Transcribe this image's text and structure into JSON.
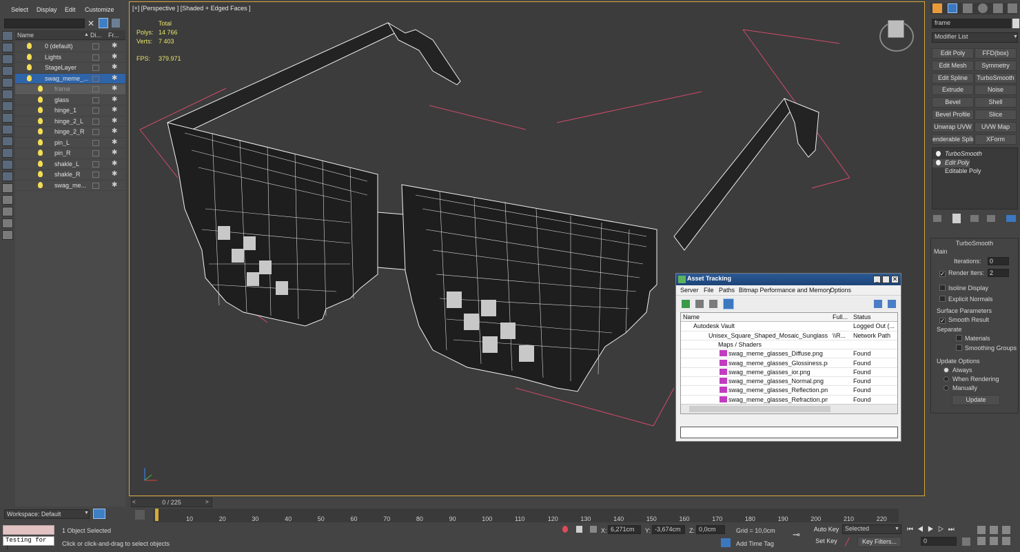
{
  "menu": {
    "select": "Select",
    "display": "Display",
    "edit": "Edit",
    "customize": "Customize"
  },
  "explorer": {
    "col_name": "Name",
    "col_display": "Di...",
    "col_freeze": "Fr...",
    "items": [
      {
        "label": "0 (default)",
        "indent": 0
      },
      {
        "label": "Lights",
        "indent": 0
      },
      {
        "label": "StageLayer",
        "indent": 0
      },
      {
        "label": "swag_meme_...",
        "indent": 0,
        "selected": true
      },
      {
        "label": "frame",
        "indent": 1,
        "highlight": true
      },
      {
        "label": "glass",
        "indent": 1
      },
      {
        "label": "hinge_1",
        "indent": 1
      },
      {
        "label": "hinge_2_L",
        "indent": 1
      },
      {
        "label": "hinge_2_R",
        "indent": 1
      },
      {
        "label": "pin_L",
        "indent": 1
      },
      {
        "label": "pin_R",
        "indent": 1
      },
      {
        "label": "shakle_L",
        "indent": 1
      },
      {
        "label": "shakle_R",
        "indent": 1
      },
      {
        "label": "swag_me...",
        "indent": 1
      }
    ],
    "workspace": "Workspace: Default"
  },
  "viewport": {
    "label": "[+] [Perspective ] [Shaded + Edged Faces ]",
    "stats": {
      "total": "Total",
      "polys_label": "Polys:",
      "polys": "14 766",
      "verts_label": "Verts:",
      "verts": "7 403",
      "fps_label": "FPS:",
      "fps": "379.971"
    }
  },
  "asset_tracking": {
    "title": "Asset Tracking",
    "menu": [
      "Server",
      "File",
      "Paths",
      "Bitmap Performance and Memory",
      "Options"
    ],
    "headers": [
      "Name",
      "Full...",
      "Status"
    ],
    "rows": [
      {
        "name": "Autodesk Vault",
        "full": "",
        "status": "Logged Out (...",
        "indent": 18
      },
      {
        "name": "Unisex_Square_Shaped_Mosaic_Sunglasse...",
        "full": "\\\\R...",
        "status": "Network Path",
        "indent": 40
      },
      {
        "name": "Maps / Shaders",
        "full": "",
        "status": "",
        "indent": 54
      },
      {
        "name": "swag_meme_glasses_Diffuse.png",
        "full": "",
        "status": "Found",
        "indent": 56,
        "png": true
      },
      {
        "name": "swag_meme_glasses_Glossiness.png",
        "full": "",
        "status": "Found",
        "indent": 56,
        "png": true
      },
      {
        "name": "swag_meme_glasses_ior.png",
        "full": "",
        "status": "Found",
        "indent": 56,
        "png": true
      },
      {
        "name": "swag_meme_glasses_Normal.png",
        "full": "",
        "status": "Found",
        "indent": 56,
        "png": true
      },
      {
        "name": "swag_meme_glasses_Reflection.png",
        "full": "",
        "status": "Found",
        "indent": 56,
        "png": true
      },
      {
        "name": "swag_meme_glasses_Refraction.png",
        "full": "",
        "status": "Found",
        "indent": 56,
        "png": true
      }
    ]
  },
  "command_panel": {
    "object_name": "frame",
    "modifier_list": "Modifier List",
    "modifier_buttons": [
      "Edit Poly",
      "FFD(box)",
      "Edit Mesh",
      "Symmetry",
      "Edit Spline",
      "TurboSmooth",
      "Extrude",
      "Noise",
      "Bevel",
      "Shell",
      "Bevel Profile",
      "Slice",
      "Unwrap UVW",
      "UVW Map",
      "enderable Splin",
      "XForm"
    ],
    "stack": [
      "TurboSmooth",
      "Edit Poly",
      "Editable Poly"
    ],
    "rollout_title": "TurboSmooth",
    "main": "Main",
    "iterations_label": "Iterations:",
    "iterations": "0",
    "render_iters_label": "Render Iters:",
    "render_iters": "2",
    "isoline": "Isoline Display",
    "explicit_normals": "Explicit Normals",
    "surface_params": "Surface Parameters",
    "smooth_result": "Smooth Result",
    "separate": "Separate",
    "materials": "Materials",
    "smoothing_groups": "Smoothing Groups",
    "update_options": "Update Options",
    "always": "Always",
    "when_rendering": "When Rendering",
    "manually": "Manually",
    "update": "Update"
  },
  "timeline": {
    "slider": "0 / 225",
    "ticks": [
      "10",
      "20",
      "30",
      "40",
      "50",
      "60",
      "70",
      "80",
      "90",
      "100",
      "110",
      "120",
      "130",
      "140",
      "150",
      "160",
      "170",
      "180",
      "190",
      "200",
      "210",
      "220"
    ]
  },
  "status_bar": {
    "script_field": "Testing for :",
    "selected": "1 Object Selected",
    "prompt": "Click or click-and-drag to select objects",
    "x_label": "X:",
    "x": "6,271cm",
    "y_label": "Y:",
    "y": "-3,674cm",
    "z_label": "Z:",
    "z": "0,0cm",
    "grid": "Grid = 10,0cm",
    "add_time_tag": "Add Time Tag",
    "auto_key": "Auto Key",
    "selected_dropdown": "Selected",
    "set_key": "Set Key",
    "key_filters": "Key Filters...",
    "frame": "0"
  }
}
